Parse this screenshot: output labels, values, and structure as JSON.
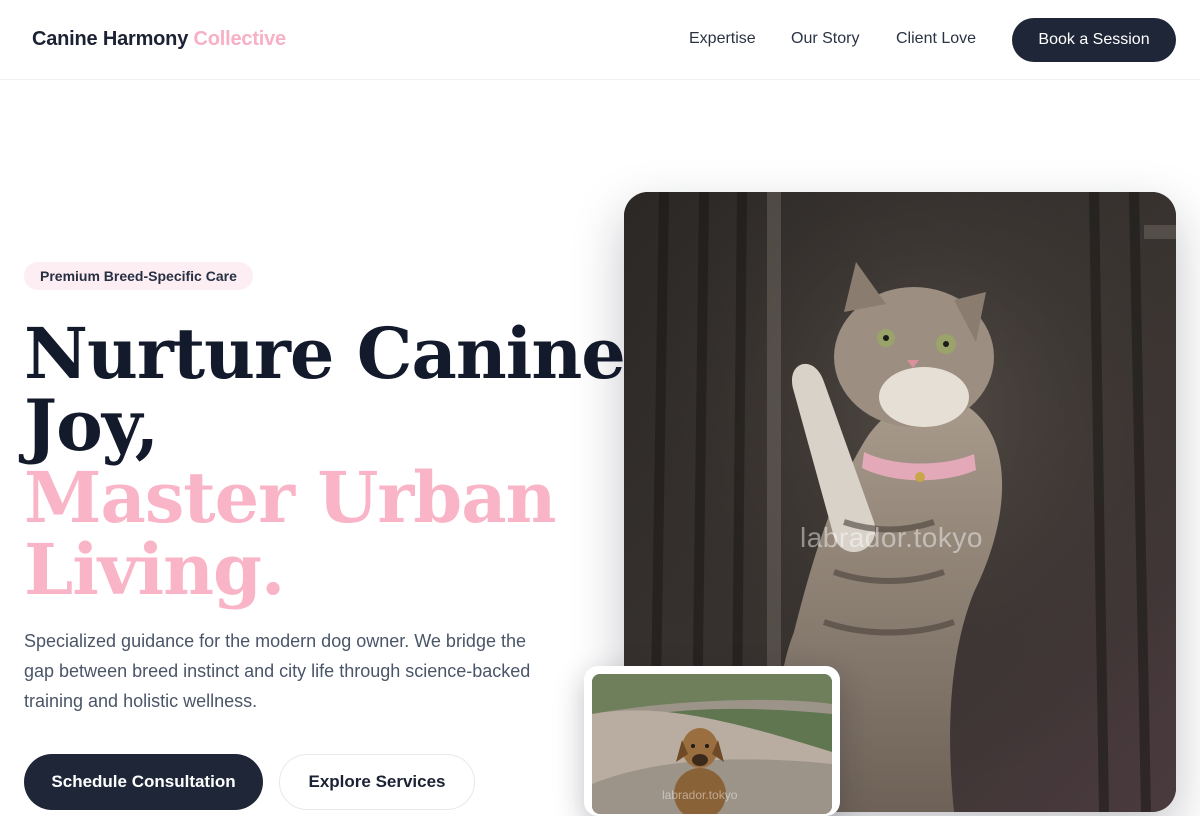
{
  "header": {
    "brand_main": "Canine Harmony",
    "brand_accent": "Collective",
    "nav": [
      {
        "label": "Expertise"
      },
      {
        "label": "Our Story"
      },
      {
        "label": "Client Love"
      }
    ],
    "cta_label": "Book a Session"
  },
  "hero": {
    "pill": "Premium Breed-Specific Care",
    "headline_dark_1": "Nurture Canine",
    "headline_dark_2": "Joy,",
    "headline_pink_1": "Master Urban",
    "headline_pink_2": "Living.",
    "lead": "Specialized guidance for the modern dog owner. We bridge the gap between breed instinct and city life through science-backed training and holistic wellness.",
    "primary_button": "Schedule Consultation",
    "secondary_button": "Explore Services",
    "image_watermark": "labrador.tokyo",
    "thumb_watermark": "labrador.tokyo"
  },
  "colors": {
    "navy": "#1e2638",
    "pink_accent": "#f9b4c7",
    "pill_bg": "#fdeef3"
  },
  "icons": {
    "hero_photo": "cat-climbing-cage-photo",
    "thumb_photo": "dog-sitting-on-path-photo"
  }
}
